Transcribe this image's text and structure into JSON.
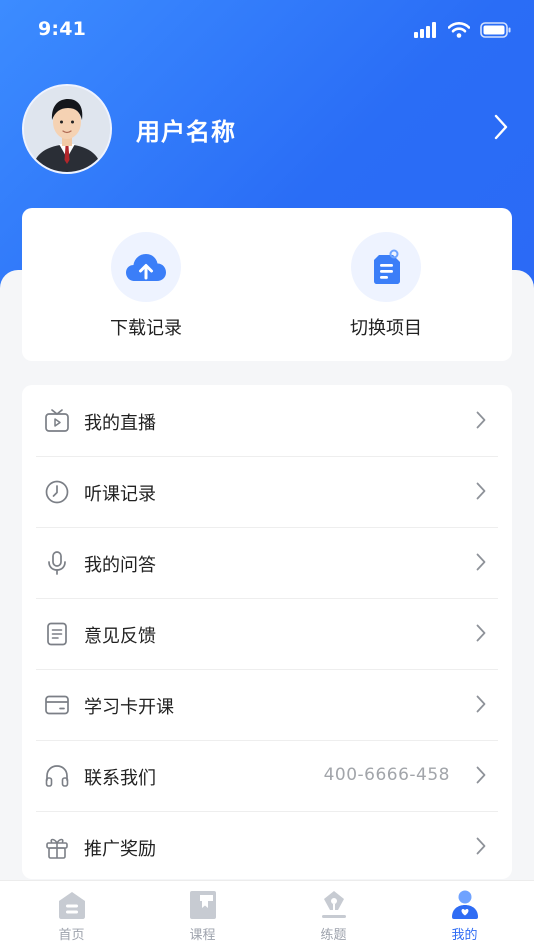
{
  "status_bar": {
    "time": "9:41"
  },
  "profile": {
    "username": "用户名称"
  },
  "quick_actions": [
    {
      "label": "下载记录",
      "icon": "cloud-upload-icon"
    },
    {
      "label": "切换项目",
      "icon": "tag-document-icon"
    }
  ],
  "menu": [
    {
      "label": "我的直播",
      "icon": "tv-play-icon",
      "value": ""
    },
    {
      "label": "听课记录",
      "icon": "clock-icon",
      "value": ""
    },
    {
      "label": "我的问答",
      "icon": "microphone-icon",
      "value": ""
    },
    {
      "label": "意见反馈",
      "icon": "document-icon",
      "value": ""
    },
    {
      "label": "学习卡开课",
      "icon": "card-icon",
      "value": ""
    },
    {
      "label": "联系我们",
      "icon": "headphones-icon",
      "value": "400-6666-458"
    },
    {
      "label": "推广奖励",
      "icon": "gift-icon",
      "value": ""
    }
  ],
  "tabbar": [
    {
      "label": "首页",
      "icon": "home-icon",
      "active": false
    },
    {
      "label": "课程",
      "icon": "book-icon",
      "active": false
    },
    {
      "label": "练题",
      "icon": "pen-icon",
      "active": false
    },
    {
      "label": "我的",
      "icon": "user-icon",
      "active": true
    }
  ],
  "colors": {
    "primary": "#2f6cf4",
    "header_gradient_start": "#3c8cff",
    "header_gradient_end": "#2a6df6",
    "muted_text": "#a2a5aa"
  }
}
